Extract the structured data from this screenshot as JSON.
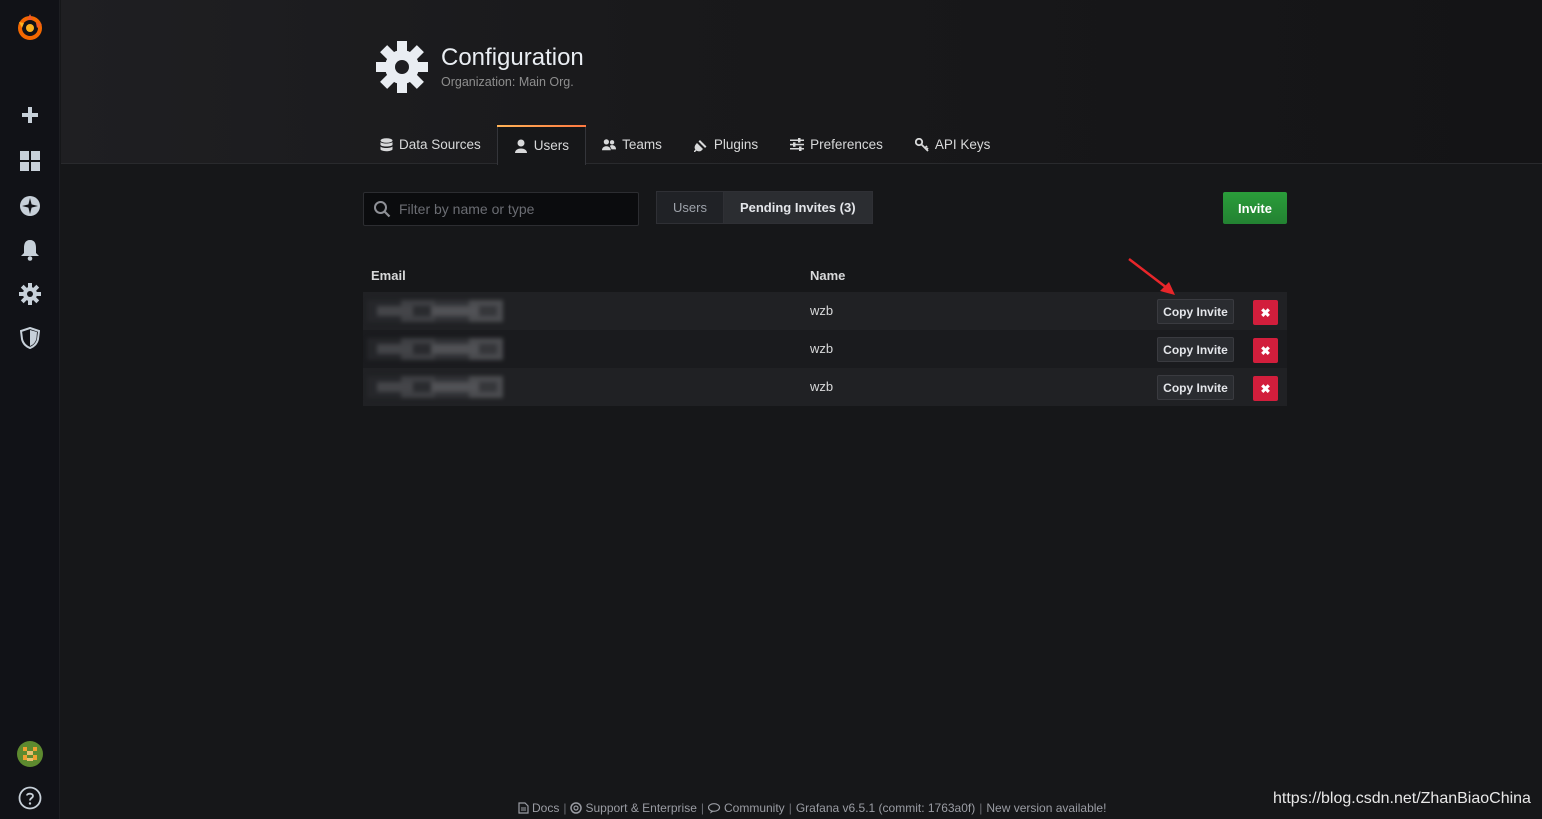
{
  "sidebar": {
    "items": [
      {
        "icon": "grafana-logo-icon"
      },
      {
        "icon": "plus-icon"
      },
      {
        "icon": "dashboards-icon"
      },
      {
        "icon": "explore-compass-icon"
      },
      {
        "icon": "alerting-bell-icon"
      },
      {
        "icon": "configuration-gear-icon"
      },
      {
        "icon": "server-admin-shield-icon"
      },
      {
        "icon": "user-avatar-icon"
      },
      {
        "icon": "help-icon"
      }
    ]
  },
  "header": {
    "title": "Configuration",
    "subtitle": "Organization: Main Org."
  },
  "tabs": [
    {
      "label": "Data Sources",
      "icon": "database-icon"
    },
    {
      "label": "Users",
      "icon": "user-icon",
      "active": true
    },
    {
      "label": "Teams",
      "icon": "users-icon"
    },
    {
      "label": "Plugins",
      "icon": "plug-icon"
    },
    {
      "label": "Preferences",
      "icon": "sliders-icon"
    },
    {
      "label": "API Keys",
      "icon": "key-icon"
    }
  ],
  "toolbar": {
    "search_placeholder": "Filter by name or type",
    "toggle_users": "Users",
    "toggle_pending": "Pending Invites (3)",
    "invite_label": "Invite"
  },
  "table": {
    "headers": {
      "email": "Email",
      "name": "Name"
    },
    "rows": [
      {
        "name": "wzb",
        "copy_label": "Copy Invite",
        "delete_label": "✖"
      },
      {
        "name": "wzb",
        "copy_label": "Copy Invite",
        "delete_label": "✖"
      },
      {
        "name": "wzb",
        "copy_label": "Copy Invite",
        "delete_label": "✖"
      }
    ]
  },
  "footer": {
    "docs": "Docs",
    "support": "Support & Enterprise",
    "community": "Community",
    "version": "Grafana v6.5.1 (commit: 1763a0f)",
    "new_version": "New version available!",
    "separator": "|"
  },
  "watermark": "https://blog.csdn.net/ZhanBiaoChina",
  "colors": {
    "accent_orange": "#ff7941",
    "invite_green": "#2a9d3a",
    "delete_red": "#d21e3c",
    "annotation_arrow": "#e8262a"
  }
}
